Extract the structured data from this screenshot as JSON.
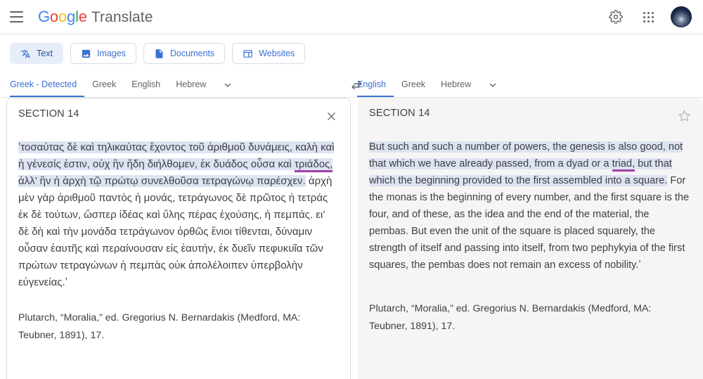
{
  "header": {
    "menu_icon": "hamburger-menu-icon",
    "brand_logo_letters": [
      "G",
      "o",
      "o",
      "g",
      "l",
      "e"
    ],
    "product_name": "Translate",
    "settings_icon": "gear-icon",
    "apps_icon": "apps-grid-icon",
    "avatar_icon": "user-avatar"
  },
  "modes": [
    {
      "label": "Text",
      "icon": "translate-text-icon",
      "active": true
    },
    {
      "label": "Images",
      "icon": "image-icon",
      "active": false
    },
    {
      "label": "Documents",
      "icon": "document-icon",
      "active": false
    },
    {
      "label": "Websites",
      "icon": "website-icon",
      "active": false
    }
  ],
  "source_languages": [
    {
      "label": "Greek - Detected",
      "active": true
    },
    {
      "label": "Greek",
      "active": false
    },
    {
      "label": "English",
      "active": false
    },
    {
      "label": "Hebrew",
      "active": false
    }
  ],
  "target_languages": [
    {
      "label": "English",
      "active": true
    },
    {
      "label": "Greek",
      "active": false
    },
    {
      "label": "Hebrew",
      "active": false
    }
  ],
  "more_languages_icon": "chevron-down-icon",
  "swap_icon": "swap-horizontal-icon",
  "source_panel": {
    "title": "SECTION 14",
    "close_icon": "close-icon",
    "text_highlighted": "ʽτοσαύτας δὲ καὶ τηλικαύτας ἔχοντος τοῦ ἀριθμοῦ δυνάμεις, καλὴ καὶ ἡ γένεσίς ἐστιν, οὐχ ἣν ἤδη διήλθομεν, ἐκ δυάδος οὖσα καὶ ",
    "text_underlined": "τριάδος,",
    "text_highlighted_2": " ἀλλ’ ἣν ἡ ἀρχὴ τῷ πρώτῳ συνελθοῦσα τετραγώνῳ παρέσχεν.",
    "text_rest": " ἀρχὴ μὲν γὰρ ἀριθμοῦ παντὸς ἡ μονάς, τετράγωνος δὲ πρῶτος ἡ τετράς ἐκ δὲ τούτων, ὥσπερ ἰδέας καὶ ὕλης πέρας ἐχούσης, ἡ πεμπάς. ει’ δὲ δὴ καὶ τὴν μονάδα τετράγωνον ὀρθῶς ἔνιοι τίθενται, δύναμιν οὖσαν ἑαυτῆς καὶ περαίνουσαν εἰς ἑαυτήν, ἐκ δυεῖν πεφυκυῖα τῶν πρώτων τετραγώνων ἡ πεμπὰς οὐκ ἀπολέλοιπεν ὑπερβολὴν εὐγενείας.ʼ",
    "citation": "Plutarch, “Moralia,” ed. Gregorius N. Bernardakis (Medford, MA: Teubner, 1891), 17."
  },
  "target_panel": {
    "title": "SECTION 14",
    "star_icon": "star-outline-icon",
    "text_highlighted": "But such and such a number of powers, the genesis is also good, not that which we have already passed, from a dyad or a ",
    "text_underlined": "triad,",
    "text_highlighted_2": " but that which the beginning provided to the first assembled into a square.",
    "text_rest": " For the monas is the beginning of every number, and the first square is the four, and of these, as the idea and the end of the material, the pembas. But even the unit of the square is placed squarely, the strength of itself and passing into itself, from two pephykyia of the first squares, the pembas does not remain an excess of nobility.ʼ",
    "citation": "Plutarch, “Moralia,” ed. Gregorius N. Bernardakis (Medford, MA: Teubner, 1891), 17."
  },
  "colors": {
    "accent_blue": "#3c6fd4",
    "highlight": "#dde3f3",
    "underline_purple": "#a23ea8",
    "target_panel_bg": "#f5f5f5",
    "text": "#3c4043"
  }
}
